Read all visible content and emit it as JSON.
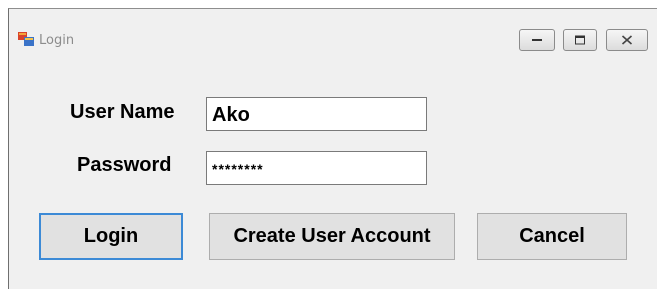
{
  "window": {
    "title": "Login",
    "icon": "app-window-icon",
    "controls": [
      "minimize-icon",
      "restore-icon",
      "close-icon"
    ]
  },
  "form": {
    "username_label": "User Name",
    "username_value": "Ako",
    "password_label": "Password",
    "password_value": "********"
  },
  "buttons": {
    "login": "Login",
    "create_account": "Create User Account",
    "cancel": "Cancel"
  },
  "colors": {
    "window_bg": "#f0f0f0",
    "focus_border": "#3c8ad6",
    "button_bg": "#e1e1e1"
  }
}
